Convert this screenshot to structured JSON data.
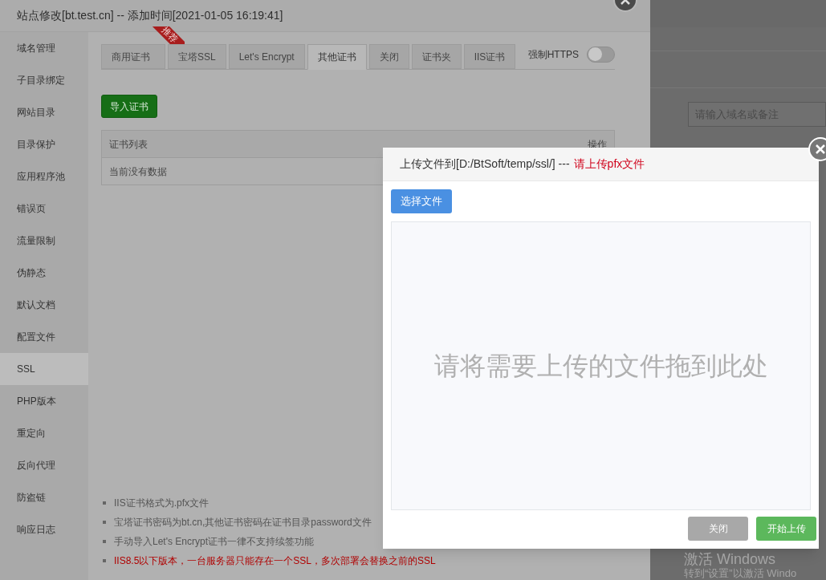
{
  "background_page": {
    "search": {
      "placeholder": "请输入域名或备注"
    }
  },
  "site_dialog": {
    "title": "站点修改[bt.test.cn] -- 添加时间[2021-01-05 16:19:41]",
    "sidebar": {
      "items": [
        {
          "label": "域名管理",
          "selected": false
        },
        {
          "label": "子目录绑定",
          "selected": false
        },
        {
          "label": "网站目录",
          "selected": false
        },
        {
          "label": "目录保护",
          "selected": false
        },
        {
          "label": "应用程序池",
          "selected": false
        },
        {
          "label": "错误页",
          "selected": false
        },
        {
          "label": "流量限制",
          "selected": false
        },
        {
          "label": "伪静态",
          "selected": false
        },
        {
          "label": "默认文档",
          "selected": false
        },
        {
          "label": "配置文件",
          "selected": false
        },
        {
          "label": "SSL",
          "selected": true
        },
        {
          "label": "PHP版本",
          "selected": false
        },
        {
          "label": "重定向",
          "selected": false
        },
        {
          "label": "反向代理",
          "selected": false
        },
        {
          "label": "防盗链",
          "selected": false
        },
        {
          "label": "响应日志",
          "selected": false
        }
      ]
    },
    "tabs": [
      {
        "label": "商用证书",
        "selected": false,
        "ribbon": "推荐"
      },
      {
        "label": "宝塔SSL",
        "selected": false
      },
      {
        "label": "Let's Encrypt",
        "selected": false
      },
      {
        "label": "其他证书",
        "selected": true
      },
      {
        "label": "关闭",
        "selected": false
      },
      {
        "label": "证书夹",
        "selected": false
      },
      {
        "label": "IIS证书",
        "selected": false
      }
    ],
    "force_https": {
      "label": "强制HTTPS",
      "on": false
    },
    "import_button": "导入证书",
    "table": {
      "columns": [
        "证书列表",
        "操作"
      ],
      "empty_text": "当前没有数据"
    },
    "notes": [
      {
        "text": "IIS证书格式为.pfx文件",
        "kind": "normal"
      },
      {
        "text": "宝塔证书密码为bt.cn,其他证书密码在证书目录password文件",
        "kind": "normal"
      },
      {
        "text": "手动导入Let's Encrypt证书一律不支持续签功能",
        "kind": "normal"
      },
      {
        "text": "IIS8.5以下版本，一台服务器只能存在一个SSL，多次部署会替换之前的SSL",
        "kind": "warning"
      }
    ]
  },
  "upload_dialog": {
    "title": "上传文件到[D:/BtSoft/temp/ssl/] ---",
    "title_hint": "请上传pfx文件",
    "choose_button": "选择文件",
    "drop_hint": "请将需要上传的文件拖到此处",
    "buttons": [
      {
        "label": "关闭",
        "kind": "secondary"
      },
      {
        "label": "开始上传",
        "kind": "primary"
      }
    ]
  },
  "os_watermark": {
    "title": "激活 Windows",
    "subtitle": "转到“设置”以激活 Windo"
  }
}
